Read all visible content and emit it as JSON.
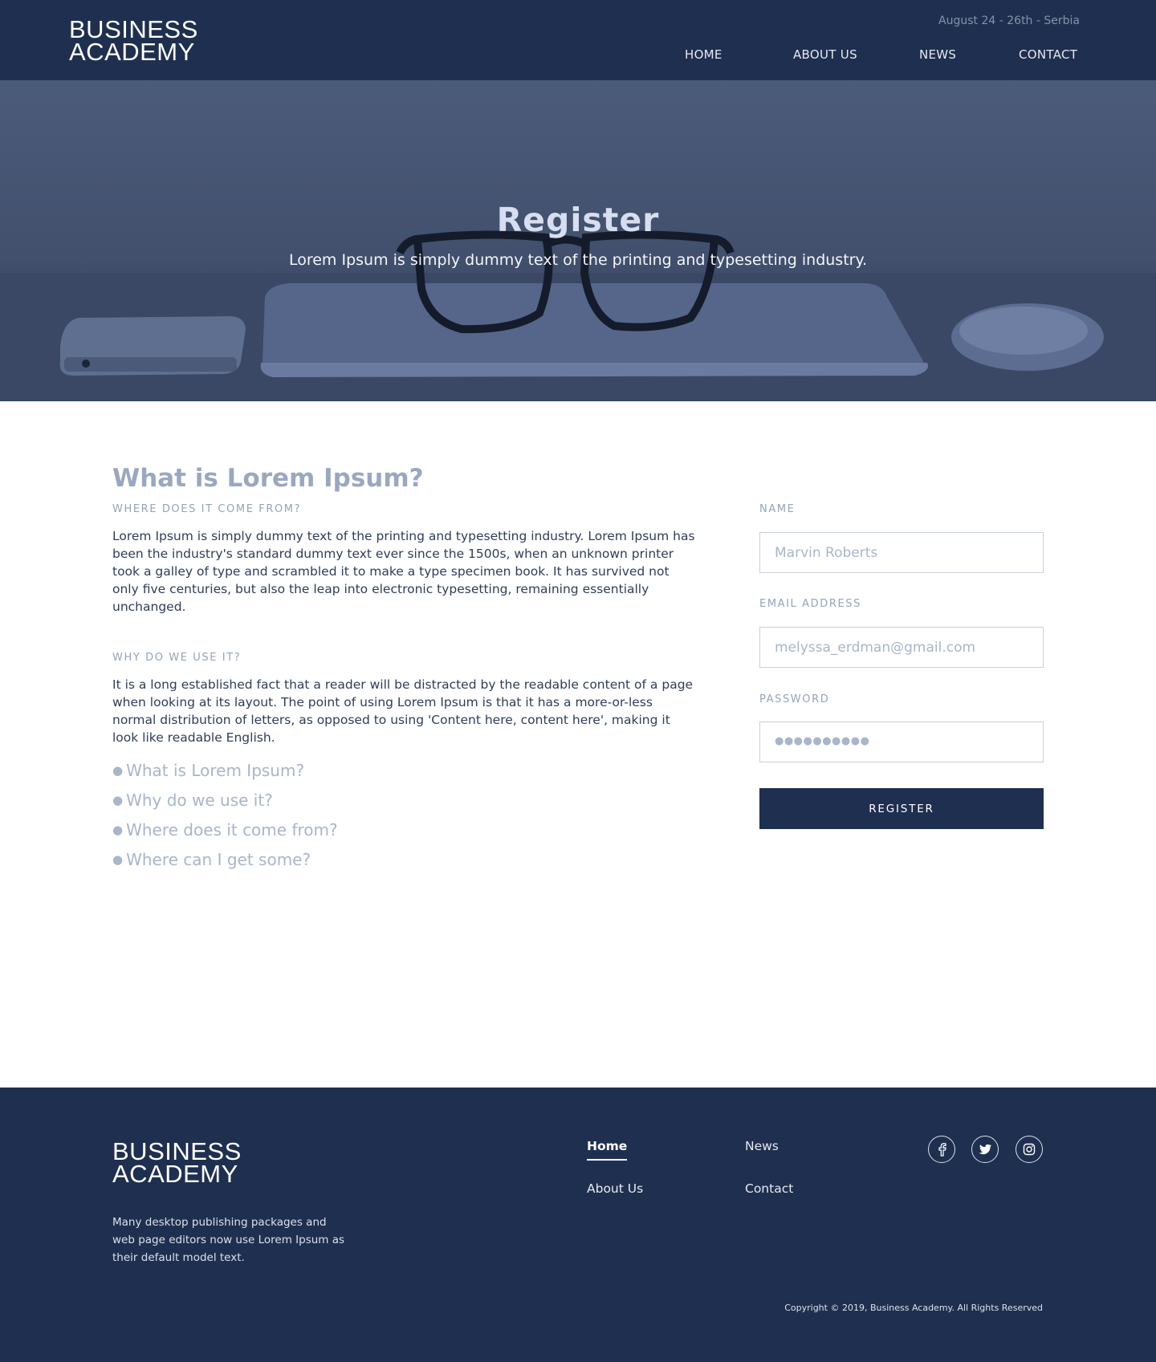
{
  "header": {
    "logo_line1": "BUSINESS",
    "logo_line2": "ACADEMY",
    "event_date": "August 24 - 26th - Serbia",
    "nav": [
      "HOME",
      "ABOUT US",
      "NEWS",
      "CONTACT"
    ]
  },
  "hero": {
    "title": "Register",
    "subtitle": "Lorem Ipsum is simply dummy text of the printing and typesetting industry."
  },
  "main": {
    "heading": "What is Lorem Ipsum?",
    "section1_label": "WHERE DOES IT COME FROM?",
    "section1_text": "Lorem Ipsum is simply dummy text of the printing and typesetting industry. Lorem Ipsum has been the industry's standard dummy text ever since the 1500s, when an unknown printer took a galley of type and scrambled it to make a type specimen book. It has survived not only five centuries, but also the leap into electronic typesetting, remaining essentially unchanged.",
    "section2_label": "WHY DO WE USE IT?",
    "section2_text": "It is a long established fact that a reader will be distracted by the readable content of a page when looking at its layout. The point of using Lorem Ipsum is that it has a more-or-less normal distribution of letters, as opposed to using 'Content here, content here', making it look like readable English.",
    "faq": [
      "What is Lorem Ipsum?",
      "Why do we use it?",
      "Where does it come from?",
      "Where can I get some?"
    ]
  },
  "form": {
    "name_label": "NAME",
    "name_placeholder": "Marvin Roberts",
    "email_label": "EMAIL ADDRESS",
    "email_placeholder": "melyssa_erdman@gmail.com",
    "password_label": "PASSWORD",
    "password_mask": "●●●●●●●●●●",
    "submit_label": "REGISTER"
  },
  "footer": {
    "logo_line1": "BUSINESS",
    "logo_line2": "ACADEMY",
    "description": "Many desktop publishing packages and web page editors now use Lorem Ipsum as their default model text.",
    "links": {
      "home": "Home",
      "news": "News",
      "about": "About Us",
      "contact": "Contact"
    },
    "social_icons": [
      "facebook-icon",
      "twitter-icon",
      "instagram-icon"
    ],
    "copyright": "Copyright © 2019, Business Academy. All Rights Reserved"
  },
  "colors": {
    "brand_navy": "#1f2f4f",
    "muted_text": "#95a3ba",
    "body_text": "#2f3d57"
  }
}
